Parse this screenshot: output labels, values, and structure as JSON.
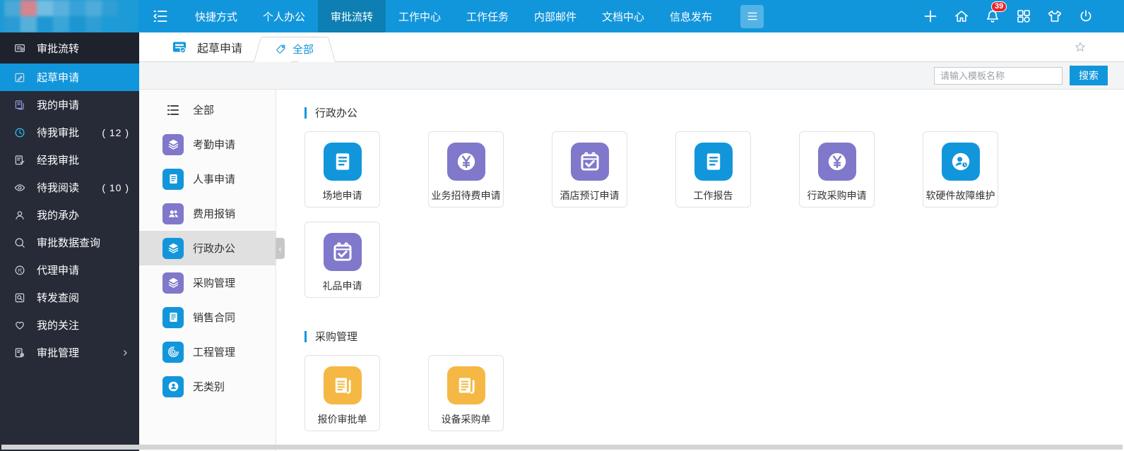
{
  "colors": {
    "primary": "#1296db",
    "primary_dark": "#0d7fb3",
    "purple": "#8078cb",
    "yellow": "#f5b844",
    "badge_red": "#e8252c",
    "sidebar_bg": "#262b37",
    "selected_grey": "#e0e0e0"
  },
  "topbar": {
    "nav_items": [
      {
        "label": "快捷方式",
        "active": false
      },
      {
        "label": "个人办公",
        "active": false
      },
      {
        "label": "审批流转",
        "active": true
      },
      {
        "label": "工作中心",
        "active": false
      },
      {
        "label": "工作任务",
        "active": false
      },
      {
        "label": "内部邮件",
        "active": false
      },
      {
        "label": "文档中心",
        "active": false
      },
      {
        "label": "信息发布",
        "active": false
      }
    ],
    "collapse_icon": "collapse-menu-icon",
    "more_icon": "hamburger-icon",
    "actions": [
      {
        "name": "add",
        "icon": "plus-icon"
      },
      {
        "name": "home",
        "icon": "home-icon"
      },
      {
        "name": "notifications",
        "icon": "bell-icon",
        "badge": "39"
      },
      {
        "name": "apps",
        "icon": "apps-grid-icon"
      },
      {
        "name": "theme",
        "icon": "shirt-icon"
      },
      {
        "name": "power",
        "icon": "power-icon"
      }
    ]
  },
  "sidebar": {
    "header": {
      "label": "审批流转",
      "icon": "approval-flow-icon"
    },
    "items": [
      {
        "label": "起草申请",
        "icon": "draft-icon",
        "active": true
      },
      {
        "label": "我的申请",
        "icon": "my-application-icon",
        "icon_color": "#949bde"
      },
      {
        "label": "待我审批",
        "count": "( 12 )",
        "icon": "pending-approval-icon",
        "icon_color": "#35c3f2"
      },
      {
        "label": "经我审批",
        "icon": "approved-by-me-icon"
      },
      {
        "label": "待我阅读",
        "count": "( 10 )",
        "icon": "pending-read-icon"
      },
      {
        "label": "我的承办",
        "icon": "my-undertaking-icon"
      },
      {
        "label": "审批数据查询",
        "icon": "search-icon"
      },
      {
        "label": "代理申请",
        "icon": "proxy-icon"
      },
      {
        "label": "转发查阅",
        "icon": "forward-read-icon"
      },
      {
        "label": "我的关注",
        "icon": "heart-icon"
      },
      {
        "label": "审批管理",
        "icon": "approval-manage-icon",
        "has_submenu": true
      }
    ]
  },
  "tabbar": {
    "breadcrumb_label": "起草申请",
    "breadcrumb_icon": "doc-check-icon",
    "tabs": [
      {
        "label": "全部",
        "icon": "tag-icon",
        "active": true
      }
    ],
    "favorite_icon": "star-icon"
  },
  "toolbar": {
    "search_placeholder": "请输入模板名称",
    "search_button_label": "搜索"
  },
  "categories": {
    "items": [
      {
        "label": "全部",
        "icon": "list-icon",
        "plain": true
      },
      {
        "label": "考勤申请",
        "icon": "layers-icon",
        "color": "purple"
      },
      {
        "label": "人事申请",
        "icon": "doc-icon",
        "color": "blue"
      },
      {
        "label": "费用报销",
        "icon": "users-icon",
        "color": "purple"
      },
      {
        "label": "行政办公",
        "icon": "layers-icon",
        "color": "blue",
        "selected": true
      },
      {
        "label": "采购管理",
        "icon": "layers-icon",
        "color": "purple"
      },
      {
        "label": "销售合同",
        "icon": "doc-icon",
        "color": "blue"
      },
      {
        "label": "工程管理",
        "icon": "fingerprint-icon",
        "color": "blue"
      },
      {
        "label": "无类别",
        "icon": "person-badge-icon",
        "color": "blue"
      }
    ],
    "collapse_handle": "‹"
  },
  "main": {
    "sections": [
      {
        "title": "行政办公",
        "cards": [
          {
            "label": "场地申请",
            "icon": "doc-icon",
            "color": "blue"
          },
          {
            "label": "业务招待费申请",
            "icon": "yen-icon",
            "color": "purple"
          },
          {
            "label": "酒店预订申请",
            "icon": "calendar-check-icon",
            "color": "purple"
          },
          {
            "label": "工作报告",
            "icon": "doc-icon",
            "color": "blue"
          },
          {
            "label": "行政采购申请",
            "icon": "yen-icon",
            "color": "purple"
          },
          {
            "label": "软硬件故障维护",
            "icon": "person-clock-icon",
            "color": "blue"
          },
          {
            "label": "礼品申请",
            "icon": "calendar-check-icon",
            "color": "purple"
          }
        ]
      },
      {
        "title": "采购管理",
        "cards": [
          {
            "label": "报价审批单",
            "icon": "invoice-icon",
            "color": "yellow"
          },
          {
            "label": "设备采购单",
            "icon": "invoice-icon",
            "color": "yellow"
          }
        ]
      }
    ]
  }
}
